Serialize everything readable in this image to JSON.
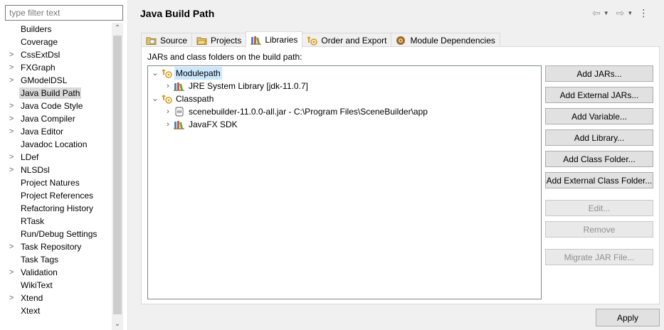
{
  "left": {
    "filter_placeholder": "type filter text",
    "items": [
      {
        "label": "Builders",
        "chevron": ""
      },
      {
        "label": "Coverage",
        "chevron": ""
      },
      {
        "label": "CssExtDsl",
        "chevron": ">"
      },
      {
        "label": "FXGraph",
        "chevron": ">"
      },
      {
        "label": "GModelDSL",
        "chevron": ">"
      },
      {
        "label": "Java Build Path",
        "chevron": ""
      },
      {
        "label": "Java Code Style",
        "chevron": ">"
      },
      {
        "label": "Java Compiler",
        "chevron": ">"
      },
      {
        "label": "Java Editor",
        "chevron": ">"
      },
      {
        "label": "Javadoc Location",
        "chevron": ""
      },
      {
        "label": "LDef",
        "chevron": ">"
      },
      {
        "label": "NLSDsl",
        "chevron": ">"
      },
      {
        "label": "Project Natures",
        "chevron": ""
      },
      {
        "label": "Project References",
        "chevron": ""
      },
      {
        "label": "Refactoring History",
        "chevron": ""
      },
      {
        "label": "RTask",
        "chevron": ""
      },
      {
        "label": "Run/Debug Settings",
        "chevron": ""
      },
      {
        "label": "Task Repository",
        "chevron": ">"
      },
      {
        "label": "Task Tags",
        "chevron": ""
      },
      {
        "label": "Validation",
        "chevron": ">"
      },
      {
        "label": "WikiText",
        "chevron": ""
      },
      {
        "label": "Xtend",
        "chevron": ">"
      },
      {
        "label": "Xtext",
        "chevron": ""
      }
    ],
    "selected_index": 5
  },
  "header": {
    "title": "Java Build Path",
    "icons": [
      "back-arrow-icon",
      "dropdown-icon",
      "forward-arrow-icon",
      "dropdown-icon",
      "view-menu-icon"
    ]
  },
  "tabs": [
    {
      "label": "Source",
      "icon": "source-folder-icon"
    },
    {
      "label": "Projects",
      "icon": "projects-icon"
    },
    {
      "label": "Libraries",
      "icon": "libraries-icon",
      "active": true
    },
    {
      "label": "Order and Export",
      "icon": "order-export-icon"
    },
    {
      "label": "Module Dependencies",
      "icon": "module-dependencies-icon"
    }
  ],
  "libraries": {
    "description": "JARs and class folders on the build path:",
    "tree": [
      {
        "label": "Modulepath",
        "icon": "modulepath-icon",
        "chevron": "v",
        "selected": true
      },
      {
        "label": "JRE System Library [jdk-11.0.7]",
        "icon": "library-icon",
        "chevron": ">"
      },
      {
        "label": "Classpath",
        "icon": "classpath-icon",
        "chevron": "v"
      },
      {
        "label": "scenebuilder-11.0.0-all.jar - C:\\Program Files\\SceneBuilder\\app",
        "icon": "jar-icon",
        "chevron": ">"
      },
      {
        "label": "JavaFX SDK",
        "icon": "library-icon",
        "chevron": ">"
      }
    ],
    "buttons": [
      {
        "label": "Add JARs...",
        "enabled": true
      },
      {
        "label": "Add External JARs...",
        "enabled": true
      },
      {
        "label": "Add Variable...",
        "enabled": true
      },
      {
        "label": "Add Library...",
        "enabled": true
      },
      {
        "label": "Add Class Folder...",
        "enabled": true
      },
      {
        "label": "Add External Class Folder...",
        "enabled": true
      },
      {
        "label": "Edit...",
        "enabled": false
      },
      {
        "label": "Remove",
        "enabled": false
      },
      {
        "label": "Migrate JAR File...",
        "enabled": false
      }
    ]
  },
  "footer": {
    "apply_label": "Apply"
  }
}
